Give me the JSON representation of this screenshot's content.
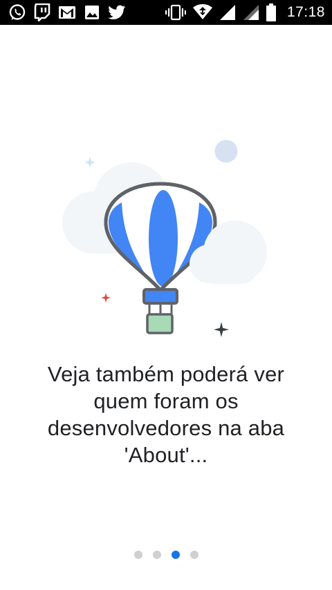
{
  "status_bar": {
    "time": "17:18",
    "left_icons": [
      "whatsapp-icon",
      "twitch-icon",
      "gmail-icon",
      "gallery-icon",
      "twitter-icon"
    ],
    "right_icons": [
      "vibrate-icon",
      "wifi-icon",
      "signal-icon",
      "signal-secondary-icon",
      "battery-icon"
    ]
  },
  "onboarding": {
    "illustration": "hot-air-balloon",
    "message": "Veja também poderá ver quem foram os desenvolvedores na aba 'About'..."
  },
  "pager": {
    "total_pages": 4,
    "current_page": 3
  },
  "colors": {
    "status_bar_bg": "#000000",
    "text": "#202124",
    "accent": "#1a73e8",
    "balloon_blue": "#4285f4",
    "basket_green": "#a8dab5",
    "dot_inactive": "#cfcfcf"
  }
}
